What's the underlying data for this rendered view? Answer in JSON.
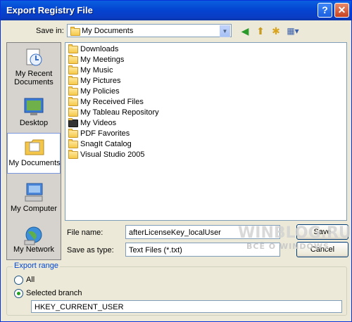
{
  "window": {
    "title": "Export Registry File"
  },
  "titlebar_buttons": {
    "help": "?",
    "close": "✕"
  },
  "save_in": {
    "label": "Save in:",
    "value": "My Documents"
  },
  "toolbar": {
    "back_glyph": "◀",
    "up_glyph": "⬆",
    "new_folder_glyph": "✱",
    "view_glyph": "▦▾"
  },
  "places": [
    {
      "label": "My Recent Documents",
      "icon": "recent-documents-icon"
    },
    {
      "label": "Desktop",
      "icon": "desktop-icon"
    },
    {
      "label": "My Documents",
      "icon": "my-documents-icon"
    },
    {
      "label": "My Computer",
      "icon": "my-computer-icon"
    },
    {
      "label": "My Network",
      "icon": "my-network-icon"
    }
  ],
  "files": [
    {
      "name": "Downloads",
      "icon": "folder-icon"
    },
    {
      "name": "My Meetings",
      "icon": "folder-icon"
    },
    {
      "name": "My Music",
      "icon": "music-folder-icon"
    },
    {
      "name": "My Pictures",
      "icon": "pictures-folder-icon"
    },
    {
      "name": "My Policies",
      "icon": "folder-icon"
    },
    {
      "name": "My Received Files",
      "icon": "folder-icon"
    },
    {
      "name": "My Tableau Repository",
      "icon": "folder-icon"
    },
    {
      "name": "My Videos",
      "icon": "videos-folder-icon"
    },
    {
      "name": "PDF Favorites",
      "icon": "folder-icon"
    },
    {
      "name": "SnagIt Catalog",
      "icon": "folder-icon"
    },
    {
      "name": "Visual Studio 2005",
      "icon": "folder-icon"
    }
  ],
  "file_name": {
    "label": "File name:",
    "value": "afterLicenseKey_localUser"
  },
  "save_as_type": {
    "label": "Save as type:",
    "value": "Text Files (*.txt)"
  },
  "buttons": {
    "save": "Save",
    "cancel": "Cancel"
  },
  "watermark": {
    "line1": "WINBLOG.RU",
    "line2": "ВСЁ О WINDOWS"
  },
  "export_range": {
    "legend": "Export range",
    "all_label": "All",
    "selected_label": "Selected branch",
    "branch_value": "HKEY_CURRENT_USER",
    "selected": "Selected branch"
  },
  "colors": {
    "title_bar": "#0445d1",
    "accent_legend": "#0046d5",
    "window_bg": "#ece9d8"
  }
}
